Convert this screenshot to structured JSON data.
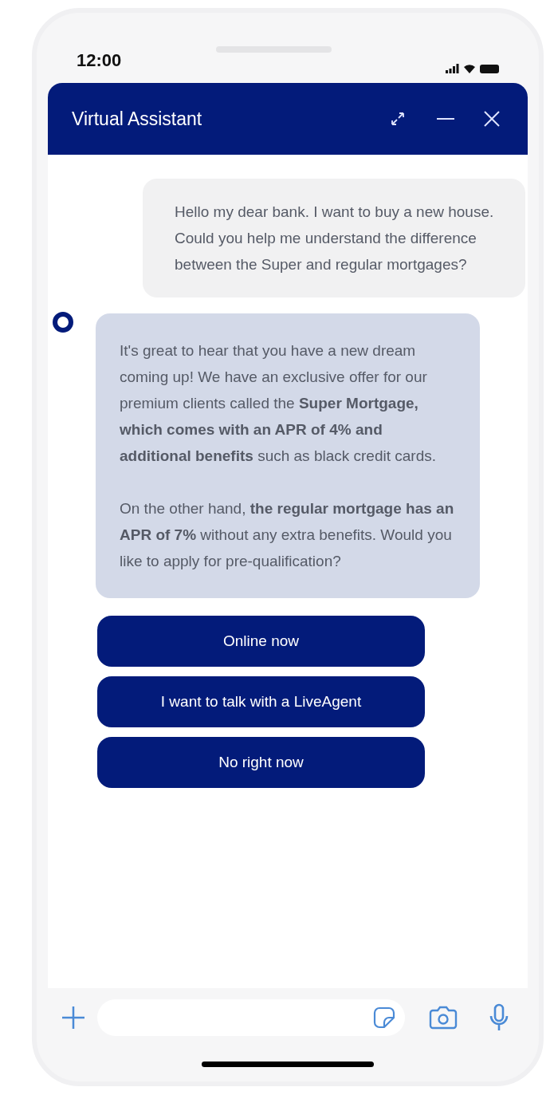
{
  "status_bar": {
    "time": "12:00"
  },
  "header": {
    "title": "Virtual Assistant"
  },
  "messages": [
    {
      "kind": "user",
      "paragraphs": [
        "Hello my dear bank. I want to buy a new house. Could you help me understand the difference between the Super and regular mortgages?"
      ]
    },
    {
      "kind": "bot",
      "paragraphs": [
        "It's great to hear that you have a new dream coming up! We have an exclusive offer for our premium clients called the **Super Mortgage, which comes with an APR of 4% and additional benefits** such as black credit cards.",
        "On the other hand, **the regular mortgage has an APR of 7%** without any extra benefits. Would you like to apply for pre-qualification?"
      ]
    }
  ],
  "quick_replies": [
    "Online now",
    "I want to talk with a LiveAgent",
    "No right now"
  ]
}
